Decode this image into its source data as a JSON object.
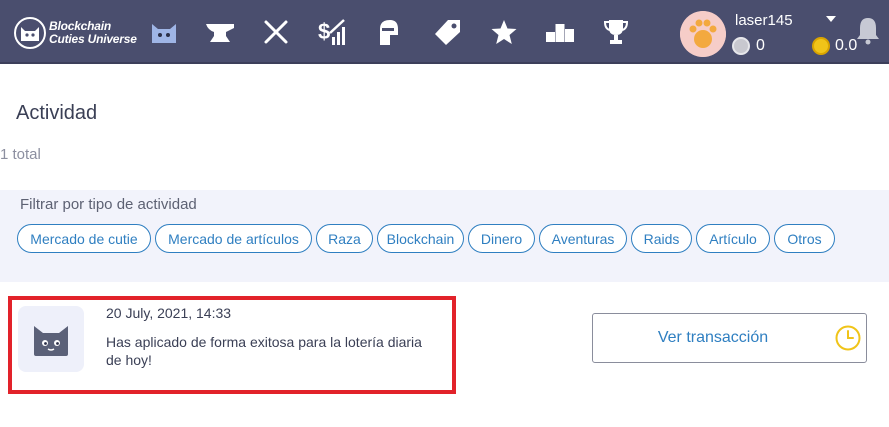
{
  "header": {
    "logo_line1": "Blockchain",
    "logo_line2": "Cuties Universe",
    "nav_icons": [
      "cutie-icon",
      "anvil-icon",
      "crossed-swords-icon",
      "dollar-chart-icon",
      "helmet-icon",
      "tag-icon",
      "star-icon",
      "podium-icon",
      "trophy-icon"
    ],
    "username": "laser145",
    "silver_balance": "0",
    "gold_balance": "0.0"
  },
  "page": {
    "title": "Actividad",
    "total": "1 total"
  },
  "filters": {
    "label": "Filtrar por tipo de actividad",
    "chips": [
      "Mercado de cutie",
      "Mercado de artículos",
      "Raza",
      "Blockchain",
      "Dinero",
      "Aventuras",
      "Raids",
      "Artículo",
      "Otros"
    ]
  },
  "activity": {
    "date": "20 July, 2021, 14:33",
    "message": "Has aplicado de forma exitosa para la lotería diaria de hoy!",
    "action_label": "Ver transacción"
  },
  "colors": {
    "header_bg": "#4a4e6e",
    "accent_blue": "#2f7fc1",
    "highlight_red": "#e2222a",
    "clock_yellow": "#f0c419"
  }
}
